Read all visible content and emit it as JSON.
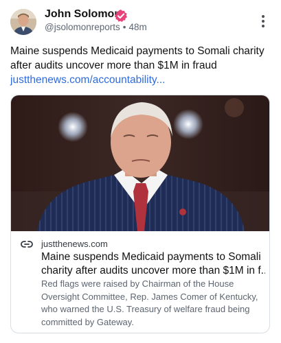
{
  "post": {
    "author": {
      "name": "John Solomon",
      "handle": "@jsolomonreports",
      "time": "48m",
      "verified": true,
      "verified_color": "#e8447a"
    },
    "text": "Maine suspends Medicaid payments to Somali charity after audits uncover more than $1M in fraud",
    "link_text": "justthenews.com/accountability...",
    "link_color": "#2d6bdc"
  },
  "card": {
    "domain": "justthenews.com",
    "title_line_1": "Maine suspends Medicaid payments to Somali",
    "title_line_2": "charity after audits uncover more than $1M in f...",
    "description": "Red flags were raised by Chairman of the House Oversight Committee, Rep. James Comer of Kentucky, who warned the U.S. Treasury of welfare fraud being committed by Gateway."
  },
  "icons": {
    "avatar": "author-avatar",
    "verified": "verified-badge-icon",
    "more": "more-options-icon",
    "link": "link-icon"
  }
}
